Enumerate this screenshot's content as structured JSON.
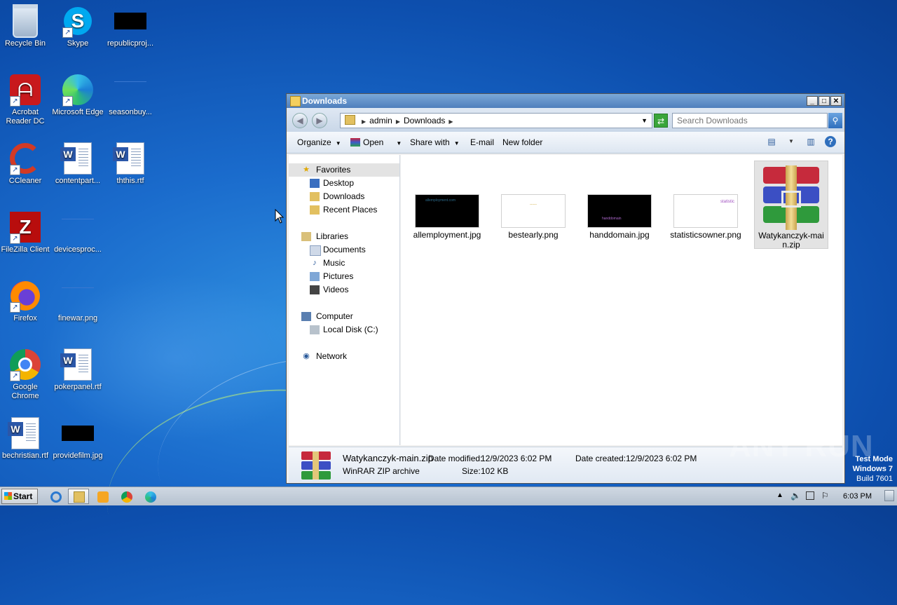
{
  "desktop": {
    "icons": [
      {
        "label": "Recycle Bin"
      },
      {
        "label": "Skype"
      },
      {
        "label": "republicproj..."
      },
      {
        "label": "Acrobat Reader DC"
      },
      {
        "label": "Microsoft Edge"
      },
      {
        "label": "seasonbuy..."
      },
      {
        "label": "CCleaner"
      },
      {
        "label": "contentpart..."
      },
      {
        "label": "ththis.rtf"
      },
      {
        "label": "FileZilla Client"
      },
      {
        "label": "devicesproc..."
      },
      {
        "label": "Firefox"
      },
      {
        "label": "finewar.png"
      },
      {
        "label": "Google Chrome"
      },
      {
        "label": "pokerpanel.rtf"
      },
      {
        "label": "bechristian.rtf"
      },
      {
        "label": "providefilm.jpg"
      }
    ]
  },
  "window": {
    "title": "Downloads",
    "controls": {
      "minimize": "_",
      "maximize": "□",
      "close": "✕"
    },
    "breadcrumb": [
      "admin",
      "Downloads"
    ],
    "search_placeholder": "Search Downloads",
    "toolbar": {
      "organize": "Organize",
      "open": "Open",
      "share_with": "Share with",
      "email": "E-mail",
      "new_folder": "New folder"
    },
    "nav": {
      "favorites": "Favorites",
      "desktop": "Desktop",
      "downloads": "Downloads",
      "recent_places": "Recent Places",
      "libraries": "Libraries",
      "documents": "Documents",
      "music": "Music",
      "pictures": "Pictures",
      "videos": "Videos",
      "computer": "Computer",
      "local_disk": "Local Disk (C:)",
      "network": "Network"
    },
    "files": [
      {
        "name": "allemployment.jpg",
        "thumb_text": "allemployment.com"
      },
      {
        "name": "bestearly.png",
        "thumb_text": "------"
      },
      {
        "name": "handdomain.jpg",
        "thumb_text": "handdomain"
      },
      {
        "name": "statisticsowner.png",
        "thumb_text": "statistic"
      },
      {
        "name": "Watykanczyk-main.zip"
      }
    ],
    "details": {
      "name": "Watykanczyk-main.zip",
      "type": "WinRAR ZIP archive",
      "modified_label": "Date modified:",
      "modified": "12/9/2023 6:02 PM",
      "created_label": "Date created:",
      "created": "12/9/2023 6:02 PM",
      "size_label": "Size:",
      "size": "102 KB"
    }
  },
  "taskbar": {
    "start": "Start",
    "clock": "6:03 PM",
    "apps": [
      "internet-explorer",
      "file-explorer",
      "media-player",
      "chrome",
      "edge"
    ]
  },
  "overlay": {
    "watermark": "ANY RUN",
    "test_mode_line1": "Test Mode",
    "test_mode_line2": "Windows 7",
    "test_mode_line3": "Build 7601"
  },
  "colors": {
    "desktop_blue": "#1a6bcc",
    "title_blue": "#4f7fbc",
    "selection_gray": "#e3e3e3"
  }
}
